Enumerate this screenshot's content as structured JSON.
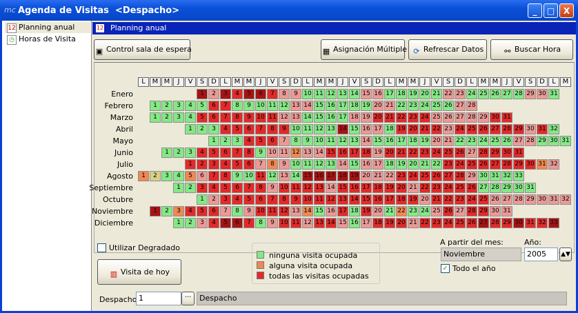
{
  "window": {
    "app_icon": "mc",
    "title": "Agenda de Visitas  <Despacho>",
    "minimize": "_",
    "maximize": "□",
    "close": "X"
  },
  "nav": {
    "items": [
      {
        "label": "Planning anual",
        "icon": "calendar-icon"
      },
      {
        "label": "Horas de Visita",
        "icon": "clock-icon"
      }
    ]
  },
  "header": {
    "title": "Planning anual"
  },
  "toolbar": {
    "control_label": "Control sala de espera",
    "asignacion_label": "Asignación Múltiple",
    "refrescar_label": "Refrescar Datos",
    "buscar_label": "Buscar Hora"
  },
  "calendar": {
    "weekday_headers": [
      "L",
      "M",
      "M",
      "J",
      "V",
      "S",
      "D",
      "L",
      "M",
      "M",
      "J",
      "V",
      "S",
      "D",
      "L",
      "M",
      "M",
      "J",
      "V",
      "S",
      "D",
      "L",
      "M",
      "M",
      "J",
      "V",
      "S",
      "D",
      "L",
      "M",
      "M",
      "J",
      "V",
      "S",
      "D",
      "L",
      "M"
    ],
    "colors": {
      "g": "#85e886",
      "p": "#ec9996",
      "r": "#e22a2a",
      "d": "#a51414",
      "o": "#f08850",
      "y": "#d8d08a"
    },
    "months": [
      {
        "name": "Enero",
        "start": 5,
        "status": "dpdrddrppgggggppgggggppgggggppg"
      },
      {
        "name": "Febrero",
        "start": 1,
        "status": "gggggrrgggggppgggggppgggggpp"
      },
      {
        "name": "Marzo",
        "start": 1,
        "status": "ggggrrrrrrrppggggpprrrrrppppprr"
      },
      {
        "name": "Abril",
        "start": 4,
        "status": "gggrrrrrrggggdgppgrrrrprrrrrrprg"
      },
      {
        "name": "Mayo",
        "start": 6,
        "status": "gggrrrpggggggpgggggppgggggppggg"
      },
      {
        "name": "Junio",
        "start": 2,
        "status": "gggrrrrrgppopprrrrprrrrrrrprrrr"
      },
      {
        "name": "Julio",
        "start": 4,
        "status": "rrrrrrpopggggpgppgggggrrrrrrrrop"
      },
      {
        "name": "Agosto",
        "start": 0,
        "status": "oyggoprrggrgpgdddddppprrrrrrpgggg"
      },
      {
        "name": "Septiembre",
        "start": 3,
        "status": "ggrrrrrrprrrrprrrrrrprrrrrggggg"
      },
      {
        "name": "Octubre",
        "start": 5,
        "status": "gprrrrrrrrrrrrrrrrrprrrrrppppppp"
      },
      {
        "name": "Noviembre",
        "start": 1,
        "status": "dgorrrpgprrrpogprgrpgoggprprrpp"
      },
      {
        "name": "Diciembre",
        "start": 3,
        "status": "ggprddrgprrprrpgprrrprrrrrdrrdrrd"
      }
    ]
  },
  "bottom": {
    "degradado_label": "Utilizar Degradado",
    "visita_hoy_label": "Visita de hoy",
    "legend": [
      {
        "label": "ninguna visita ocupada",
        "color": "#85e886"
      },
      {
        "label": "alguna visita ocupada",
        "color": "#f08850"
      },
      {
        "label": "todas las visitas ocupadas",
        "color": "#e22a2a"
      }
    ],
    "partir_label": "A partir del mes:",
    "mes_value": "Noviembre",
    "anio_label": "Año:",
    "anio_value": "2005",
    "todo_label": "Todo el año",
    "despacho_label": "Despacho:",
    "despacho_value": "1",
    "despacho_btn": "···",
    "despacho_name": "Despacho"
  }
}
